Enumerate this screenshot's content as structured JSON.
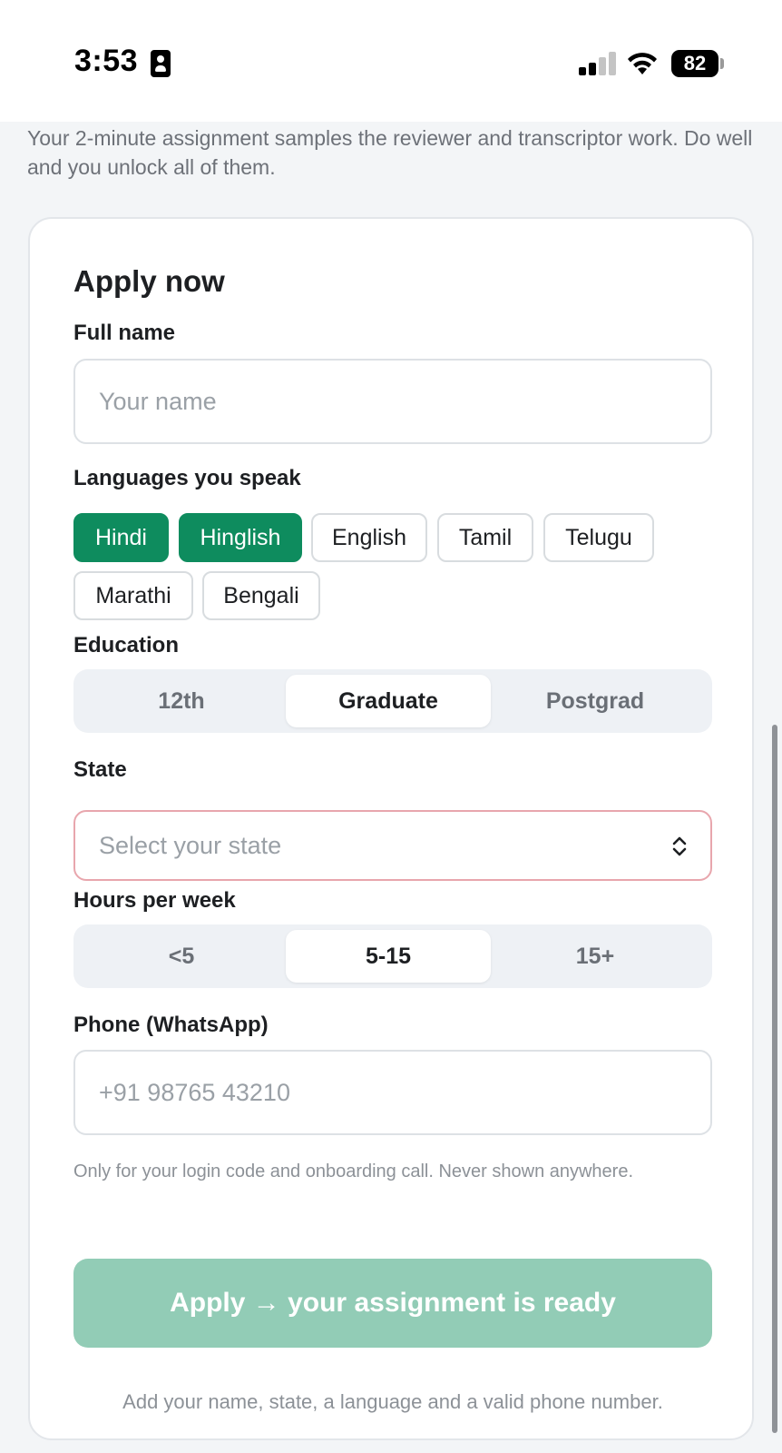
{
  "status_bar": {
    "time": "3:53",
    "battery": "82"
  },
  "intro_text": "Your 2-minute assignment samples the reviewer and transcriptor work. Do well and you unlock all of them.",
  "form": {
    "title": "Apply now",
    "full_name": {
      "label": "Full name",
      "placeholder": "Your name",
      "value": ""
    },
    "languages": {
      "label": "Languages you speak",
      "options": [
        {
          "label": "Hindi",
          "selected": true
        },
        {
          "label": "Hinglish",
          "selected": true
        },
        {
          "label": "English",
          "selected": false
        },
        {
          "label": "Tamil",
          "selected": false
        },
        {
          "label": "Telugu",
          "selected": false
        },
        {
          "label": "Marathi",
          "selected": false
        },
        {
          "label": "Bengali",
          "selected": false
        }
      ]
    },
    "education": {
      "label": "Education",
      "options": [
        "12th",
        "Graduate",
        "Postgrad"
      ],
      "selected": "Graduate"
    },
    "state": {
      "label": "State",
      "placeholder": "Select your state"
    },
    "hours": {
      "label": "Hours per week",
      "options": [
        "<5",
        "5-15",
        "15+"
      ],
      "selected": "5-15"
    },
    "phone": {
      "label": "Phone (WhatsApp)",
      "placeholder": "+91 98765 43210",
      "value": "",
      "hint": "Only for your login code and onboarding call. Never shown anywhere."
    },
    "submit_label": "Apply → your assignment is ready",
    "footnote": "Add your name, state, a language and a valid phone number."
  },
  "colors": {
    "accent": "#0e8c5e",
    "submit_disabled": "#92ccb6",
    "error_border": "#e8a6ad"
  }
}
